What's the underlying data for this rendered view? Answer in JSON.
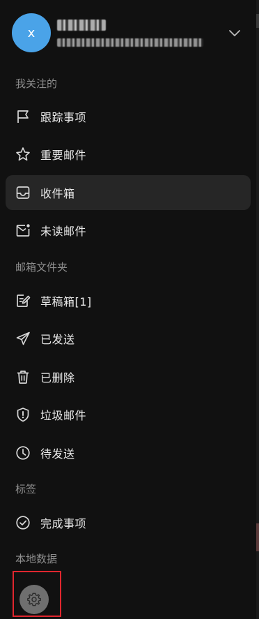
{
  "account": {
    "avatar_initial": "x",
    "name": "",
    "email": ""
  },
  "sections": {
    "following": "我关注的",
    "folders": "邮箱文件夹",
    "tags": "标签",
    "local": "本地数据"
  },
  "items": [
    {
      "label": "跟踪事项",
      "icon": "flag-icon"
    },
    {
      "label": "重要邮件",
      "icon": "star-icon"
    },
    {
      "label": "收件箱",
      "icon": "inbox-icon",
      "active": true
    },
    {
      "label": "未读邮件",
      "icon": "unread-mail-icon"
    },
    {
      "label": "草稿箱[1]",
      "icon": "draft-icon"
    },
    {
      "label": "已发送",
      "icon": "send-icon"
    },
    {
      "label": "已删除",
      "icon": "trash-icon"
    },
    {
      "label": "垃圾邮件",
      "icon": "spam-icon"
    },
    {
      "label": "待发送",
      "icon": "clock-icon"
    },
    {
      "label": "完成事项",
      "icon": "check-circle-icon"
    }
  ],
  "settings_icon": "gear-icon",
  "colors": {
    "avatar": "#4aa3e8",
    "drawer_bg": "#111111",
    "active_item_bg": "#262626",
    "highlight_border": "#e0262e"
  }
}
